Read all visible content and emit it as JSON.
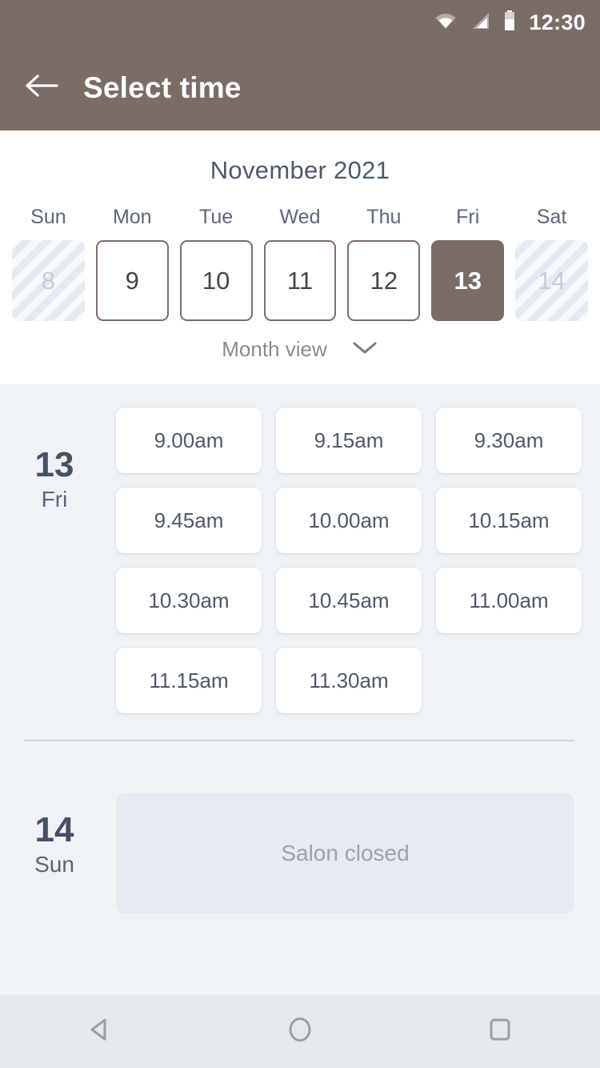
{
  "statusbar": {
    "time": "12:30",
    "icons": [
      "wifi-icon",
      "cellular-signal-icon",
      "battery-icon"
    ]
  },
  "appbar": {
    "back_icon": "arrow-left-icon",
    "title": "Select time",
    "background_color": "#7a6d67"
  },
  "calendar": {
    "month_title": "November 2021",
    "weekdays": [
      "Sun",
      "Mon",
      "Tue",
      "Wed",
      "Thu",
      "Fri",
      "Sat"
    ],
    "days": [
      {
        "label": "8",
        "state": "disabled"
      },
      {
        "label": "9",
        "state": "normal"
      },
      {
        "label": "10",
        "state": "normal"
      },
      {
        "label": "11",
        "state": "normal"
      },
      {
        "label": "12",
        "state": "normal"
      },
      {
        "label": "13",
        "state": "selected"
      },
      {
        "label": "14",
        "state": "disabled"
      }
    ],
    "view_toggle": {
      "label": "Month view",
      "icon": "chevron-down-icon"
    },
    "accent_color": "#7a6d67",
    "title_color": "#4e5969"
  },
  "schedule": [
    {
      "day_number": "13",
      "day_name": "Fri",
      "slots": [
        "9.00am",
        "9.15am",
        "9.30am",
        "9.45am",
        "10.00am",
        "10.15am",
        "10.30am",
        "10.45am",
        "11.00am",
        "11.15am",
        "11.30am"
      ]
    },
    {
      "day_number": "14",
      "day_name": "Sun",
      "closed_label": "Salon closed"
    }
  ],
  "navbar": {
    "buttons": [
      {
        "name": "back-nav-button",
        "icon": "triangle-left-icon"
      },
      {
        "name": "home-nav-button",
        "icon": "circle-icon"
      },
      {
        "name": "recents-nav-button",
        "icon": "square-icon"
      }
    ]
  }
}
